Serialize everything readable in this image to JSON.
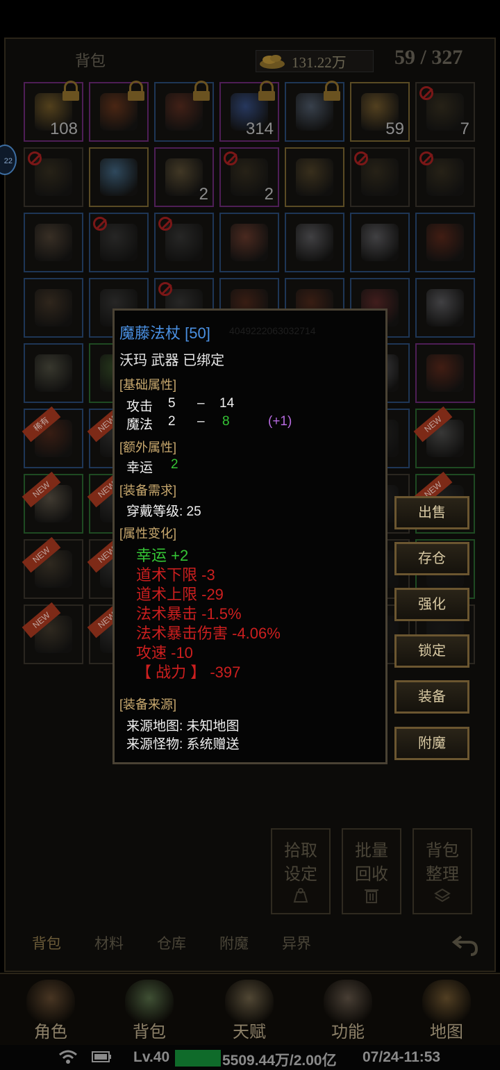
{
  "header": {
    "title": "背包",
    "gold": "131.22万",
    "capacity": "59 / 327"
  },
  "side_bubble": "22",
  "grid": {
    "rows": [
      [
        {
          "count": "108",
          "border": "purple",
          "lock": true,
          "color": "#8a6a2a",
          "icon": "scroll-icon"
        },
        {
          "count": "",
          "border": "purple",
          "lock": true,
          "color": "#7a3a1a",
          "icon": "chest-icon"
        },
        {
          "count": "",
          "border": "blue",
          "lock": true,
          "color": "#6a3020",
          "icon": "medallion-icon"
        },
        {
          "count": "314",
          "border": "purple",
          "lock": true,
          "color": "#3a5aa0",
          "icon": "map-scroll-icon"
        },
        {
          "count": "",
          "border": "blue",
          "lock": true,
          "color": "#5a6a80",
          "icon": "silver-chest-icon"
        },
        {
          "count": "59",
          "border": "gold",
          "lock": false,
          "color": "#8a6a30",
          "icon": "gourd-icon"
        },
        {
          "count": "7",
          "border": "none",
          "ban": true,
          "color": "#3a3220",
          "icon": "book-icon"
        }
      ],
      [
        {
          "count": "",
          "border": "none",
          "ban": true,
          "color": "#3a3220",
          "icon": "book-icon"
        },
        {
          "count": "",
          "border": "gold",
          "color": "#4a7aa0",
          "icon": "crystal-icon"
        },
        {
          "count": "2",
          "border": "purple",
          "color": "#6a5a3a",
          "icon": "key-icon"
        },
        {
          "count": "2",
          "border": "purple",
          "ban": true,
          "color": "#3a3220",
          "icon": "book-icon"
        },
        {
          "count": "",
          "border": "gold",
          "color": "#5a4a2a",
          "icon": "skill-book-icon"
        },
        {
          "count": "",
          "border": "none",
          "ban": true,
          "color": "#3a3220",
          "icon": "book-icon"
        },
        {
          "count": "",
          "border": "none",
          "ban": true,
          "color": "#3a3220",
          "icon": "book-icon"
        }
      ],
      [
        {
          "count": "",
          "border": "blue",
          "color": "#5a4a3a",
          "icon": "skull-helmet-icon"
        },
        {
          "count": "",
          "border": "blue",
          "ban": true,
          "color": "#3a3a3a",
          "icon": "gauntlet-icon"
        },
        {
          "count": "",
          "border": "blue",
          "ban": true,
          "color": "#3a3a3a",
          "icon": "gauntlet-icon"
        },
        {
          "count": "",
          "border": "blue",
          "color": "#7a4030",
          "icon": "bracer-icon"
        },
        {
          "count": "",
          "border": "blue",
          "color": "#6a6a70",
          "icon": "glove-icon"
        },
        {
          "count": "",
          "border": "blue",
          "color": "#6a6a70",
          "icon": "glove-icon"
        },
        {
          "count": "",
          "border": "blue",
          "color": "#6a2a1a",
          "icon": "staff-icon"
        }
      ],
      [
        {
          "count": "",
          "border": "blue",
          "color": "#4a3a2a",
          "icon": "dagger-icon"
        },
        {
          "count": "",
          "border": "blue",
          "color": "#3a3a3a",
          "icon": "necklace-icon"
        },
        {
          "count": "",
          "border": "blue",
          "ban": true,
          "color": "#3a3a3a",
          "icon": "gauntlet-icon"
        },
        {
          "count": "",
          "border": "blue",
          "color": "#5a2a1a",
          "icon": "sword-icon"
        },
        {
          "count": "",
          "border": "blue",
          "color": "#5a2a1a",
          "icon": "sword-icon"
        },
        {
          "count": "",
          "border": "blue",
          "color": "#6a2a2a",
          "icon": "mask-icon"
        },
        {
          "count": "",
          "border": "blue",
          "color": "#6a6a70",
          "icon": "glove-icon"
        }
      ],
      [
        {
          "count": "",
          "border": "blue",
          "color": "#5a5a4a",
          "icon": "ring-icon"
        },
        {
          "count": "",
          "border": "green",
          "color": "#3a5a2a",
          "icon": "arrow-up-icon"
        },
        {
          "count": "",
          "border": "blue",
          "color": "#2a2a2a",
          "icon": "item-icon"
        },
        {
          "count": "",
          "border": "blue",
          "color": "#2a2a2a",
          "icon": "item-icon"
        },
        {
          "count": "",
          "border": "blue",
          "color": "#2a2a2a",
          "icon": "item-icon"
        },
        {
          "count": "",
          "border": "blue",
          "color": "#6a6a70",
          "icon": "glove-icon"
        },
        {
          "count": "",
          "border": "purple",
          "color": "#6a2a1a",
          "icon": "staff-icon"
        }
      ],
      [
        {
          "count": "",
          "border": "blue",
          "tag": "稀有",
          "color": "#5a2a1a",
          "icon": "sword-icon"
        },
        {
          "count": "",
          "border": "blue",
          "tag": "NEW",
          "color": "#3a3a3a",
          "icon": "item-icon"
        },
        {
          "count": "",
          "border": "blue",
          "color": "#2a2a2a",
          "icon": "item-icon"
        },
        {
          "count": "",
          "border": "blue",
          "color": "#2a2a2a",
          "icon": "item-icon"
        },
        {
          "count": "",
          "border": "blue",
          "color": "#2a2a2a",
          "icon": "item-icon"
        },
        {
          "count": "",
          "border": "blue",
          "color": "#2a2a2a",
          "icon": "item-icon"
        },
        {
          "count": "",
          "border": "green",
          "tag": "NEW",
          "color": "#5a5a5a",
          "icon": "shield-icon"
        }
      ],
      [
        {
          "count": "",
          "border": "green",
          "tag": "NEW",
          "color": "#6a6050",
          "icon": "tooth-necklace-icon"
        },
        {
          "count": "",
          "border": "green",
          "tag": "NEW",
          "color": "#3a3a3a",
          "icon": "item-icon"
        },
        {
          "count": "",
          "border": "none",
          "color": "#2a2a2a",
          "icon": "item-icon"
        },
        {
          "count": "",
          "border": "none",
          "color": "#2a2a2a",
          "icon": "item-icon"
        },
        {
          "count": "",
          "border": "none",
          "color": "#2a2a2a",
          "icon": "item-icon"
        },
        {
          "count": "",
          "border": "none",
          "color": "#2a2a2a",
          "icon": "item-icon"
        },
        {
          "count": "",
          "border": "green",
          "tag": "NEW",
          "color": "#2a2a2a",
          "icon": "item-icon"
        }
      ],
      [
        {
          "count": "",
          "border": "none",
          "tag": "NEW",
          "color": "#4a4030",
          "icon": "armor-icon"
        },
        {
          "count": "",
          "border": "none",
          "tag": "NEW",
          "color": "#3a3a3a",
          "icon": "item-icon"
        },
        {
          "count": "",
          "border": "none",
          "color": "#1a1a1a",
          "icon": "item-icon"
        },
        {
          "count": "",
          "border": "none",
          "color": "#1a1a1a",
          "icon": "item-icon"
        },
        {
          "count": "",
          "border": "none",
          "color": "#1a1a1a",
          "icon": "item-icon"
        },
        {
          "count": "",
          "border": "none",
          "color": "#1a1a1a",
          "icon": "item-icon"
        },
        {
          "count": "",
          "border": "green",
          "color": "#1a1a1a",
          "icon": "item-icon"
        }
      ],
      [
        {
          "count": "",
          "border": "none",
          "tag": "NEW",
          "color": "#4a4030",
          "icon": "armor-icon"
        },
        {
          "count": "",
          "border": "none",
          "tag": "NEW",
          "color": "#3a3a3a",
          "icon": "item-icon"
        },
        {
          "count": "",
          "border": "none",
          "color": "#1a1a1a",
          "icon": "item-icon"
        },
        {
          "count": "",
          "border": "none",
          "color": "#1a1a1a",
          "icon": "item-icon"
        },
        {
          "count": "",
          "border": "none",
          "color": "#1a1a1a",
          "icon": "item-icon"
        },
        {
          "count": "",
          "border": "none",
          "color": "#1a1a1a",
          "icon": "item-icon"
        },
        {
          "count": "",
          "border": "none",
          "color": "#1a1a1a",
          "icon": "item-icon"
        }
      ]
    ]
  },
  "tooltip": {
    "name": "魔藤法杖 [50]",
    "id": "4049222063032714",
    "type_line": "沃玛 武器 已绑定",
    "basic_header": "[基础属性]",
    "attack_label": "攻击",
    "attack_min": "5",
    "dash": "–",
    "attack_max": "14",
    "magic_label": "魔法",
    "magic_min": "2",
    "magic_max": "8",
    "magic_bonus": "(+1)",
    "extra_header": "[额外属性]",
    "luck_label": "幸运",
    "luck_val": "2",
    "req_header": "[装备需求]",
    "req_level": "穿戴等级: 25",
    "change_header": "[属性变化]",
    "changes": [
      {
        "text": "幸运 +2",
        "kind": "up"
      },
      {
        "text": "道术下限 -3",
        "kind": "down"
      },
      {
        "text": "道术上限 -29",
        "kind": "down"
      },
      {
        "text": "法术暴击 -1.5%",
        "kind": "down"
      },
      {
        "text": "法术暴击伤害 -4.06%",
        "kind": "down"
      },
      {
        "text": "攻速 -10",
        "kind": "down"
      },
      {
        "text": "【 战力 】 -397",
        "kind": "down"
      }
    ],
    "source_header": "[装备来源]",
    "source_map": "来源地图:  未知地图",
    "source_monster": "来源怪物:  系统赠送"
  },
  "actions": [
    "出售",
    "存仓",
    "强化",
    "锁定",
    "装备",
    "附魔"
  ],
  "utility_buttons": [
    {
      "line1": "拾取",
      "line2": "设定",
      "icon": "bag-icon"
    },
    {
      "line1": "批量",
      "line2": "回收",
      "icon": "trash-icon"
    },
    {
      "line1": "背包",
      "line2": "整理",
      "icon": "layers-icon"
    }
  ],
  "tabs": [
    "背包",
    "材料",
    "仓库",
    "附魔",
    "异界"
  ],
  "nav": [
    {
      "label": "角色",
      "icon": "hooded-figure-icon",
      "color": "#7a5a3a"
    },
    {
      "label": "背包",
      "icon": "backpack-icon",
      "color": "#6a8a5a"
    },
    {
      "label": "天赋",
      "icon": "dragon-icon",
      "color": "#8a7a5a"
    },
    {
      "label": "功能",
      "icon": "anvil-icon",
      "color": "#7a6a5a"
    },
    {
      "label": "地图",
      "icon": "compass-map-icon",
      "color": "#8a6a3a"
    }
  ],
  "status": {
    "level": "Lv.40",
    "exp": "5509.44万/2.00亿",
    "time": "07/24-11:53",
    "exp_fill": 0.5
  }
}
